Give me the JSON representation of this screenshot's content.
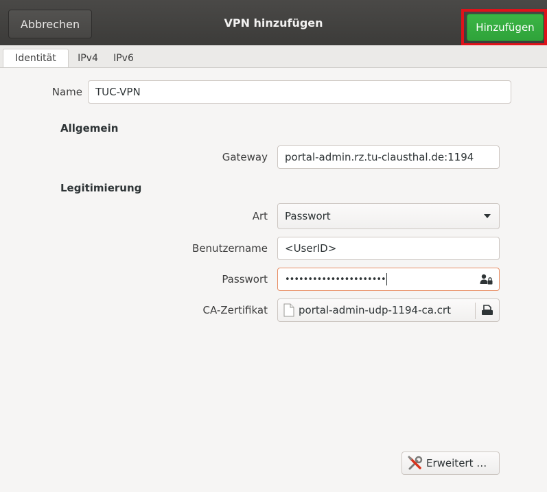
{
  "header": {
    "cancel_label": "Abbrechen",
    "title": "VPN hinzufügen",
    "add_label": "Hinzufügen",
    "add_color": "#33a93e",
    "highlight_color": "#e0121a"
  },
  "tabs": [
    {
      "label": "Identität",
      "active": true
    },
    {
      "label": "IPv4",
      "active": false
    },
    {
      "label": "IPv6",
      "active": false
    }
  ],
  "form": {
    "name_label": "Name",
    "name_value": "TUC-VPN",
    "section_general": "Allgemein",
    "gateway_label": "Gateway",
    "gateway_value": "portal-admin.rz.tu-clausthal.de:1194",
    "section_auth": "Legitimierung",
    "type_label": "Art",
    "type_value": "Passwort",
    "username_label": "Benutzername",
    "username_value": "<UserID>",
    "password_label": "Passwort",
    "password_value": "••••••••••••••••••••••",
    "ca_label": "CA-Zertifikat",
    "ca_value": "portal-admin-udp-1194-ca.crt",
    "advanced_label": "Erweitert …"
  },
  "icons": {
    "password_store": "user-lock-icon",
    "file": "document-icon",
    "open_file": "open-file-icon",
    "advanced": "wrench-screwdriver-icon"
  }
}
